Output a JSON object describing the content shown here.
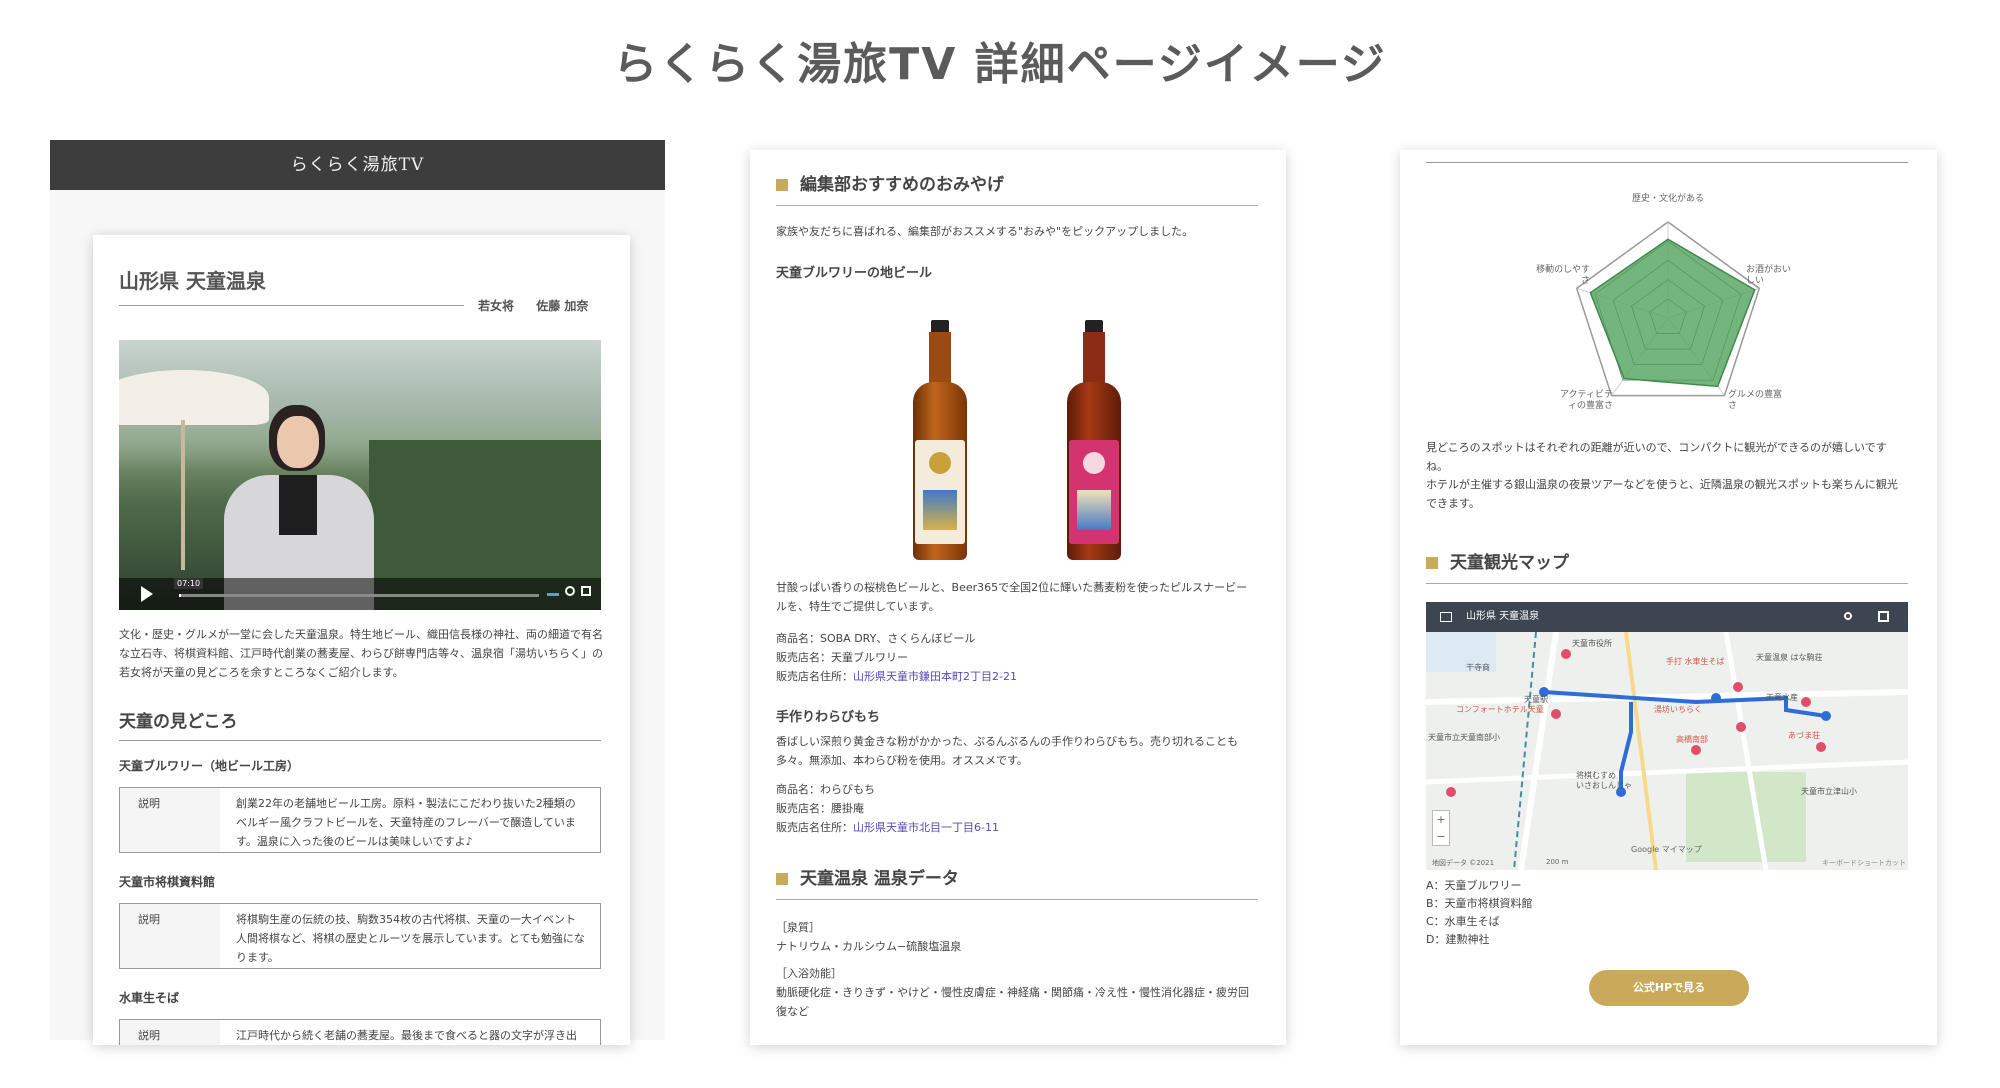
{
  "page_title": "らくらく湯旅TV 詳細ページイメージ",
  "panel1": {
    "logo": "らくらく湯旅TV",
    "onsen_title": "山形県 天童温泉",
    "guide_role": "若女将",
    "guide_name": "佐藤 加奈",
    "video_time": "07:10",
    "intro": "文化・歴史・グルメが一堂に会した天童温泉。特生地ビール、織田信長様の神社、両の細道で有名な立石寺、将棋資料館、江戸時代創業の蕎麦屋、わらび餅専門店等々、温泉宿「湯坊いちらく」の若女将が天童の見どころを余すところなくご紹介します。",
    "section_title": "天童の見どころ",
    "spots": [
      {
        "name": "天童ブルワリー（地ビール工房）",
        "label": "説明",
        "desc": "創業22年の老舗地ビール工房。原料・製法にこだわり抜いた2種類のベルギー風クラフトビールを、天童特産のフレーバーで醸造しています。温泉に入った後のビールは美味しいですよ♪"
      },
      {
        "name": "天童市将棋資料館",
        "label": "説明",
        "desc": "将棋駒生産の伝統の技、駒数354枚の古代将棋、天童の一大イベント人間将棋など、将棋の歴史とルーツを展示しています。とても勉強になります。"
      },
      {
        "name": "水車生そば",
        "label": "説明",
        "desc": "江戸時代から続く老舗の蕎麦屋。最後まで食べると器の文字が浮き出"
      }
    ]
  },
  "panel2": {
    "souvenir_title": "編集部おすすめのおみやげ",
    "souvenir_intro": "家族や友だちに喜ばれる、編集部がおススメする\"おみや\"をピックアップしました。",
    "item1_title": "天童ブルワリーの地ビール",
    "item1_desc": "甘酸っぱい香りの桜桃色ビールと、Beer365で全国2位に輝いた蕎麦粉を使ったピルスナービールを、特生でご提供しています。",
    "item1_product": "商品名：SOBA DRY、さくらんぼビール",
    "item1_shop": "販売店名：天童ブルワリー",
    "item1_addr_label": "販売店名住所：",
    "item1_addr": "山形県天童市鎌田本町2丁目2-21",
    "item2_title": "手作りわらびもち",
    "item2_desc": "香ばしい深煎り黄金きな粉がかかった、ぷるんぷるんの手作りわらびもち。売り切れることも多々。無添加、本わらび粉を使用。オススメです。",
    "item2_product": "商品名：わらびもち",
    "item2_shop": "販売店名：腰掛庵",
    "item2_addr_label": "販売店名住所：",
    "item2_addr": "山形県天童市北目一丁目6-11",
    "data_title": "天童温泉 温泉データ",
    "spring_label": "［泉質］",
    "spring_value": "ナトリウム・カルシウム−硫酸塩温泉",
    "effect_label": "［入浴効能］",
    "effect_value": "動脈硬化症・きりきず・やけど・慢性皮膚症・神経痛・関節痛・冷え性・慢性消化器症・疲労回復など"
  },
  "panel3": {
    "radar_labels": [
      "歴史・文化がある",
      "お酒がおいしい",
      "グルメの豊富さ",
      "アクティビティの豊富さ",
      "移動のしやすさ"
    ],
    "radar_values": [
      0.82,
      0.95,
      0.88,
      0.78,
      0.85
    ],
    "radar_color": "#5aa865",
    "comment1": "見どころのスポットはそれぞれの距離が近いので、コンパクトに観光ができるのが嬉しいですね。",
    "comment2": "ホテルが主催する銀山温泉の夜景ツアーなどを使うと、近隣温泉の観光スポットも楽ちんに観光できます。",
    "map_title": "天童観光マップ",
    "map_header": "山形県 天童温泉",
    "map_places": [
      "天童市役所",
      "手打 水車生そば",
      "天童温泉 はな駒荘",
      "コンフォートホテル天童",
      "天童市立天童南部小",
      "湯坊いちらく",
      "高橋南部",
      "あづま荘",
      "天童市立津山小",
      "将棋むすめ",
      "天童駅",
      "いさおしんじゃ",
      "天童水産",
      "干寺商"
    ],
    "map_footer_left": "地図データ ©2021",
    "map_footer_scale": "200 m",
    "map_footer_right": "キーボードショートカット",
    "map_google": "Google マイマップ",
    "legend": [
      "A：天童ブルワリー",
      "B：天童市将棋資料館",
      "C：水車生そば",
      "D：建勲神社"
    ],
    "button": "公式HPで見る",
    "accent": "#c8aa5a"
  }
}
